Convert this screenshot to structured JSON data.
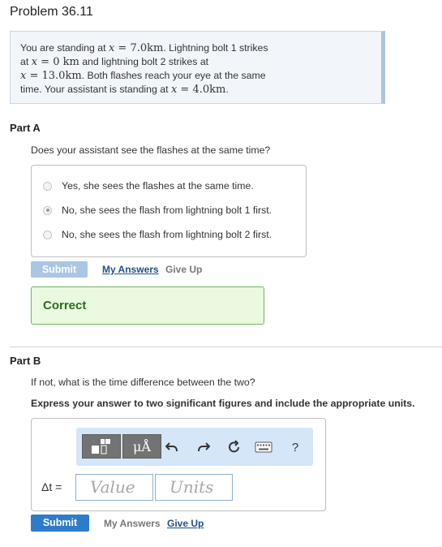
{
  "problem": {
    "title": "Problem 36.11",
    "text": {
      "s1": "You are standing at ",
      "m1_var": "x",
      "m1_eq": " = 7.0km",
      "s2": ". Lightning bolt 1 strikes",
      "s3": "at ",
      "m2_var": "x",
      "m2_eq": " = 0 km",
      "s4": " and lightning bolt 2 strikes at",
      "m3_var": "x",
      "m3_eq": " = 13.0km",
      "s5": ". Both flashes reach your eye at the same",
      "s6": "time. Your assistant is standing at ",
      "m4_var": "x",
      "m4_eq": " = 4.0km",
      "s7": "."
    }
  },
  "partA": {
    "heading": "Part A",
    "question": "Does your assistant see the flashes at the same time?",
    "options": [
      {
        "label": "Yes, she sees the flashes at the same time.",
        "selected": false
      },
      {
        "label": "No, she sees the flash from lightning bolt 1 first.",
        "selected": true
      },
      {
        "label": "No, she sees the flash from lightning bolt 2 first.",
        "selected": false
      }
    ],
    "submit_label": "Submit",
    "my_answers_label": "My Answers",
    "give_up_label": "Give Up",
    "feedback": "Correct"
  },
  "partB": {
    "heading": "Part B",
    "question": "If not, what is the time difference between the two?",
    "instructions": "Express your answer to two significant figures and include the appropriate units.",
    "toolbar": {
      "templates_icon": "templates-icon",
      "units_label": "μÅ",
      "undo_icon": "undo-icon",
      "redo_icon": "redo-icon",
      "reset_icon": "reset-icon",
      "keyboard_icon": "keyboard-icon",
      "help_label": "?"
    },
    "variable_label": "Δt =",
    "value_placeholder": "Value",
    "units_placeholder": "Units",
    "submit_label": "Submit",
    "my_answers_label": "My Answers",
    "give_up_label": "Give Up"
  },
  "colors": {
    "accent": "#2d7ccb",
    "correct_bg": "#eaf9e0",
    "correct_border": "#6cb85c",
    "toolbar_bg": "#d4e6f8"
  }
}
